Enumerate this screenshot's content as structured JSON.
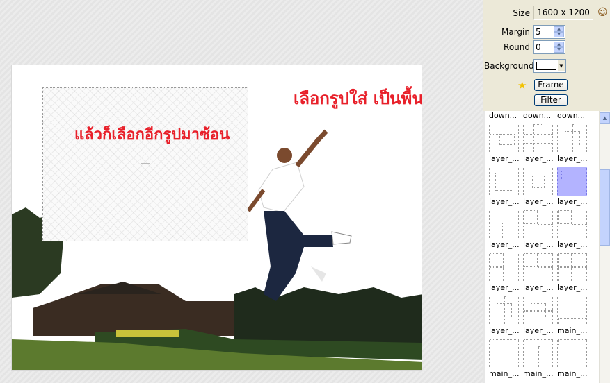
{
  "toolbar": {
    "size_label": "Size",
    "size_value": "1600 x 1200",
    "margin_label": "Margin",
    "margin_value": "5",
    "round_label": "Round",
    "round_value": "0",
    "background_label": "Background",
    "frame_button": "Frame",
    "filter_button": "Filter"
  },
  "canvas": {
    "annotation_top": "เลือกรูปใส่ เป็นพื้น",
    "annotation_left": "แล้วก็เลือกอีกรูปมาซ้อน"
  },
  "thumbnails": {
    "header_row": [
      "down...",
      "down...",
      "down..."
    ],
    "rows": [
      [
        "layer_...",
        "layer_...",
        "layer_..."
      ],
      [
        "layer_...",
        "layer_...",
        "layer_..."
      ],
      [
        "layer_...",
        "layer_...",
        "layer_..."
      ],
      [
        "layer_...",
        "layer_...",
        "layer_..."
      ],
      [
        "layer_...",
        "layer_...",
        "main_..."
      ],
      [
        "main_...",
        "main_...",
        "main_..."
      ]
    ]
  },
  "colors": {
    "annotation": "#e8202a",
    "selected_thumb": "#b3b3ff",
    "panel_bg": "#ece9d8"
  },
  "icons": {
    "star": "star-icon",
    "avatar": "avatar-icon"
  }
}
